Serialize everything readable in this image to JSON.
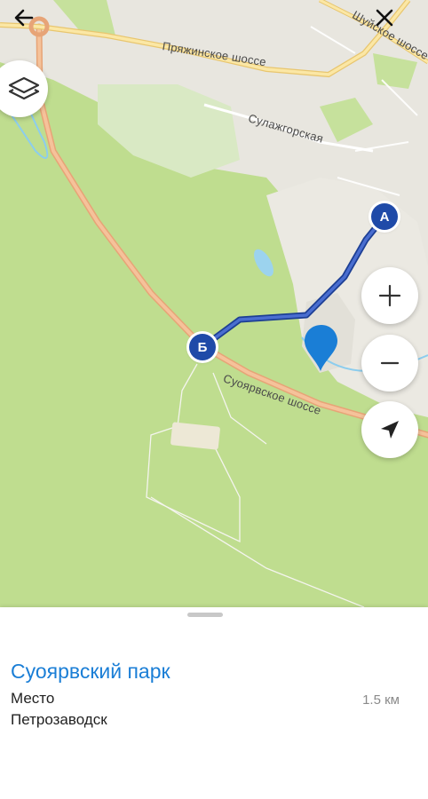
{
  "map": {
    "roads": {
      "road_1": "Пряжинское шоссе",
      "road_2": "Сулажгорская",
      "road_3": "Суоярвское шоссе",
      "road_4": "Шуйское шоссе"
    },
    "markers": {
      "start": "А",
      "end": "Б"
    },
    "route_color": "#3a5db8",
    "pin_color": "#1a7ed6"
  },
  "toolbar": {
    "back_icon": "arrow-left-icon",
    "close_icon": "close-icon",
    "layers_icon": "layers-icon"
  },
  "controls": {
    "zoom_in_icon": "plus-icon",
    "zoom_out_icon": "minus-icon",
    "locate_icon": "navigation-arrow-icon"
  },
  "place": {
    "title": "Суоярвский парк",
    "type": "Место",
    "city": "Петрозаводск",
    "distance": "1.5 км"
  }
}
